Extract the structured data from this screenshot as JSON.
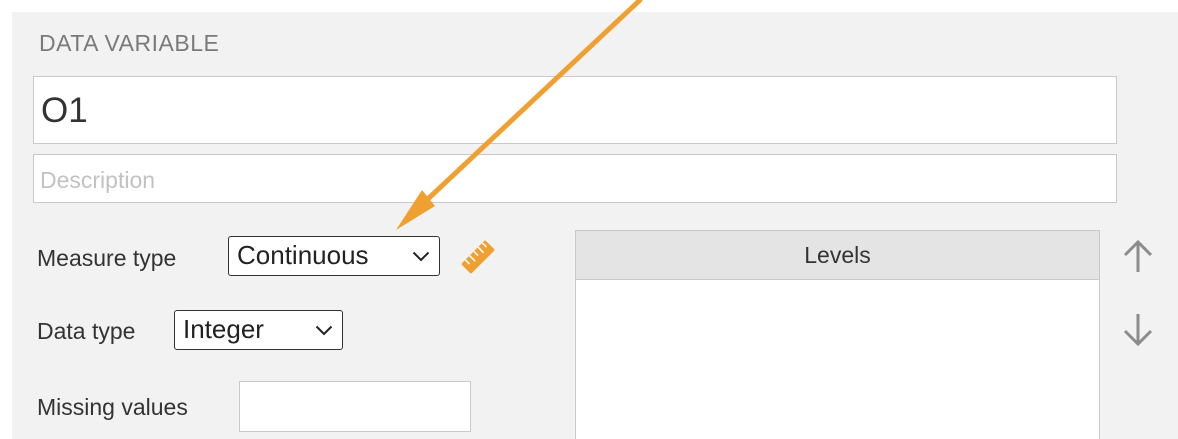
{
  "panel": {
    "title": "DATA VARIABLE",
    "name_value": "O1",
    "description_placeholder": "Description"
  },
  "measure_type": {
    "label": "Measure type",
    "selected": "Continuous",
    "icon": "ruler-icon"
  },
  "data_type": {
    "label": "Data type",
    "selected": "Integer"
  },
  "missing_values": {
    "label": "Missing values",
    "value": ""
  },
  "levels": {
    "header": "Levels",
    "items": []
  },
  "level_controls": {
    "up_icon": "arrow-up-icon",
    "down_icon": "arrow-down-icon"
  },
  "colors": {
    "accent_arrow": "#f0a030",
    "ruler": "#f0a030",
    "panel_bg": "#f2f2f2"
  }
}
